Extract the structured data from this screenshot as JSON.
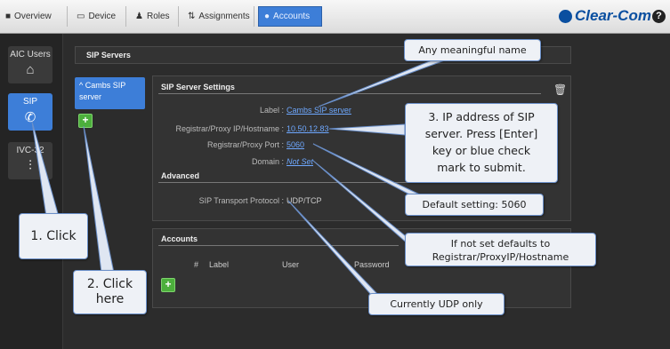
{
  "tabs": [
    {
      "label": "Overview",
      "icon": "grid-icon",
      "active": false
    },
    {
      "label": "Device",
      "icon": "device-icon",
      "active": false
    },
    {
      "label": "Roles",
      "icon": "people-icon",
      "active": false
    },
    {
      "label": "Assignments",
      "icon": "assign-icon",
      "active": false
    },
    {
      "label": "Accounts",
      "icon": "accounts-icon",
      "active": true
    }
  ],
  "brand": "Clear-Com",
  "help_label": "?",
  "nav": [
    {
      "label": "AIC Users",
      "icon": "user-icon",
      "active": false
    },
    {
      "label": "SIP",
      "icon": "phone-icon",
      "active": true
    },
    {
      "label": "IVC-32",
      "icon": "mixer-icon",
      "active": false
    }
  ],
  "sip_servers": {
    "title": "SIP Servers",
    "list": [
      {
        "label": "Cambs SIP",
        "label2": "server"
      }
    ],
    "add_label": "+"
  },
  "settings": {
    "title": "SIP Server Settings",
    "fields": [
      {
        "label": "Label :",
        "value": "Cambs SIP server"
      },
      {
        "label": "Registrar/Proxy IP/Hostname :",
        "value": "10.50.12.83"
      },
      {
        "label": "Registrar/Proxy Port :",
        "value": "5060"
      },
      {
        "label": "Domain :",
        "value": "Not Set"
      }
    ],
    "advanced_title": "Advanced",
    "transport": {
      "label": "SIP Transport Protocol :",
      "value": "UDP/TCP"
    }
  },
  "accounts": {
    "title": "Accounts",
    "columns": [
      "#",
      "Label",
      "User",
      "Password"
    ],
    "add_label": "+"
  },
  "callouts": {
    "name": "Any meaningful name",
    "ip_lines": [
      "3. IP address of SIP",
      "server. Press [Enter]",
      "key or blue check",
      "mark to submit."
    ],
    "port": "Default setting: 5060",
    "domain_lines": [
      "If not set defaults to",
      "Registrar/ProxyIP/Hostname"
    ],
    "udp": "Currently UDP only",
    "click1": "1. Click",
    "click2_lines": [
      "2. Click",
      "here"
    ]
  },
  "colors": {
    "accent": "#3d7ed8",
    "add_green": "#4caf3c",
    "link": "#6ea8ff"
  }
}
